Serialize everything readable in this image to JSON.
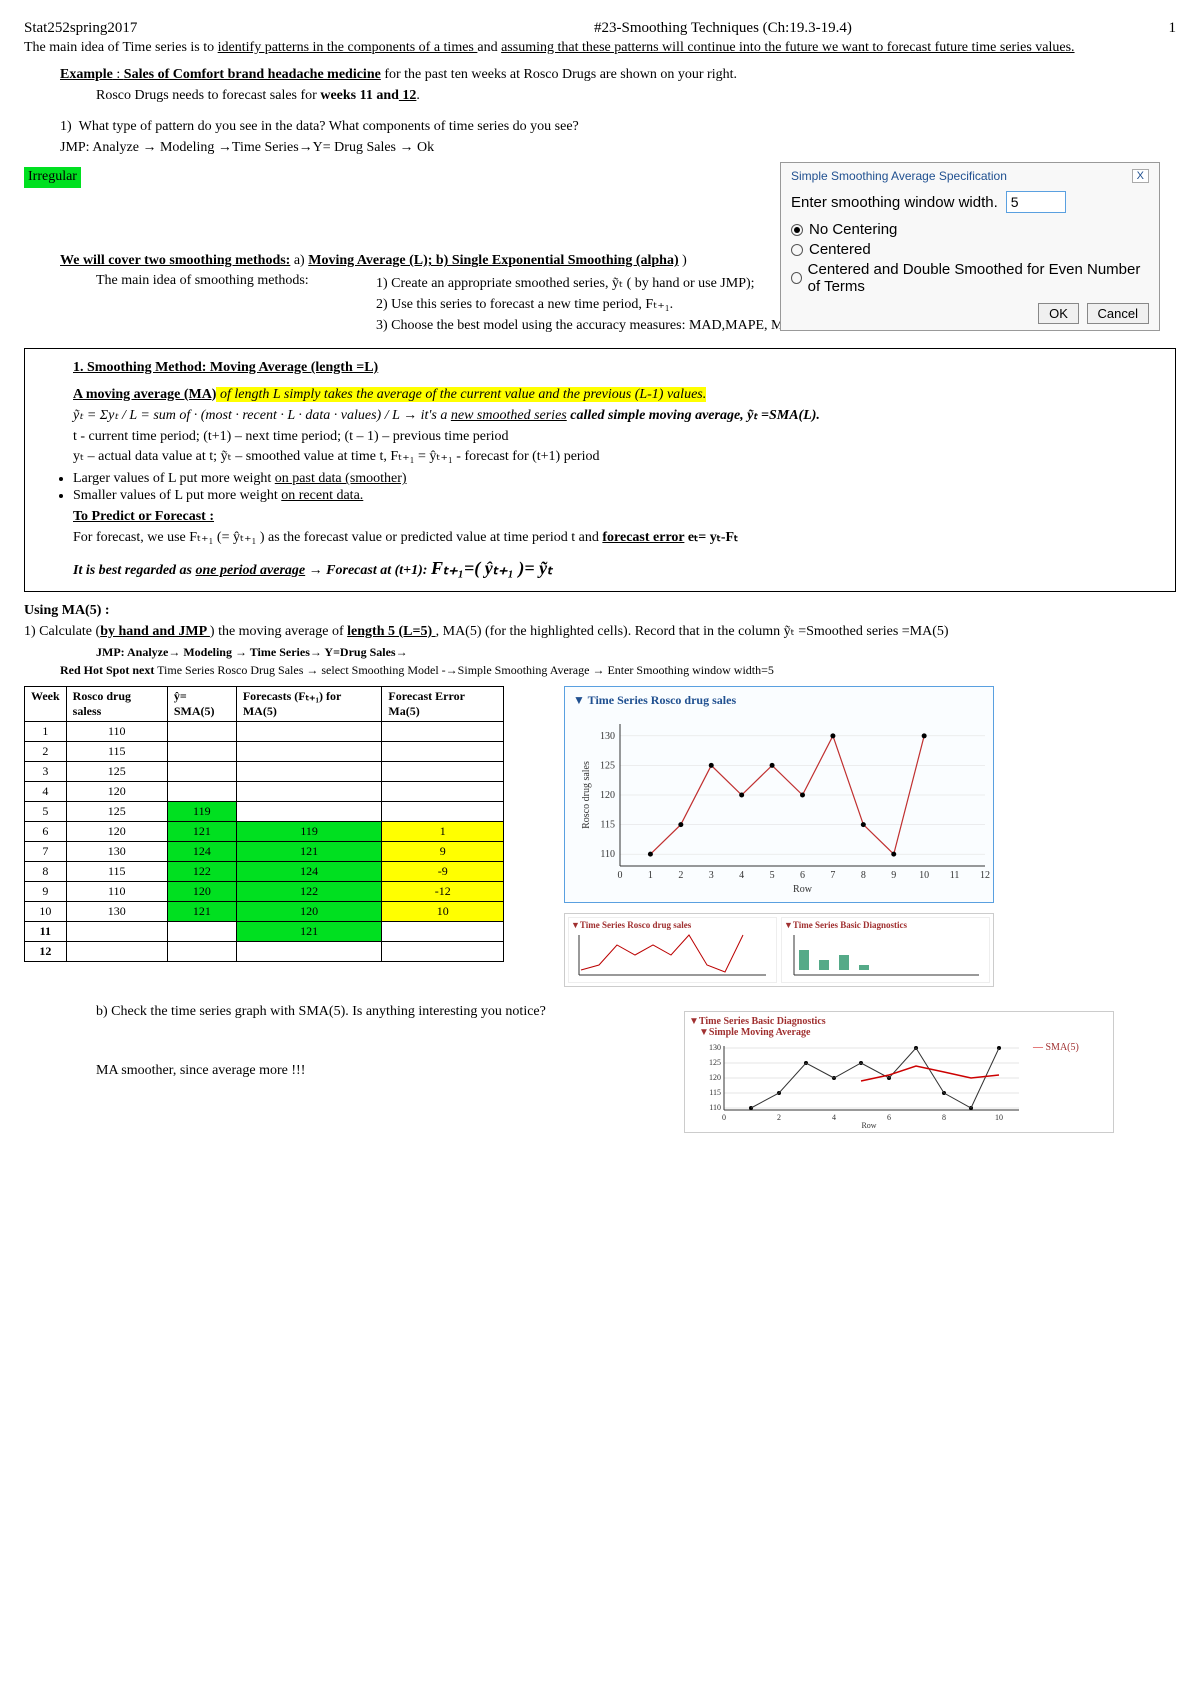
{
  "header": {
    "course": "Stat252spring2017",
    "title": "#23-Smoothing Techniques (Ch:19.3-19.4)",
    "page": "1"
  },
  "intro": {
    "line1a": "The main idea of Time series is to ",
    "line1b": "identify patterns in the components of a times ",
    "line1c": "and ",
    "line1d": "assuming that these patterns will continue into the future we want to forecast future time series values.",
    "example_pre": "Example",
    "example_title": "Sales of Comfort brand headache medicine",
    "example_rest": " for the past ten weeks at Rosco Drugs are shown on your right.",
    "rosco_line": "Rosco Drugs needs to forecast sales for ",
    "rosco_bold": "weeks 11 and",
    "rosco_bold2": " 12",
    "q1_num": "1)",
    "q1_text": "What type of pattern do you see in the data? What components of time series do you see?",
    "jmp_label": "JMP:",
    "jmp_path": "Analyze → Modeling →Time Series→Y= Drug Sales → Ok",
    "irregular": "Irregular"
  },
  "dialog": {
    "title": "Simple Smoothing Average Specification",
    "close": "X",
    "enter_label": "Enter smoothing window width.",
    "enter_value": "5",
    "r1": "No Centering",
    "r2": "Centered",
    "r3": "Centered and Double Smoothed for Even Number of Terms",
    "ok": "OK",
    "cancel": "Cancel"
  },
  "methods": {
    "cover_line_pre": "We will cover two smoothing methods:",
    "cover_line_a": " a) ",
    "cover_line_b": "Moving Average (L); b) Single Exponential Smoothing (alpha)",
    "cover_line_end": " )",
    "idea_label": "The main idea of smoothing methods:",
    "step1": "1) Create an appropriate smoothed series, ỹₜ ( by hand or use JMP);",
    "step2": "2)  Use this series to forecast a new time period, Fₜ₊₁.",
    "step3": "3)  Choose the best model using the accuracy measures: MAD,MAPE, MSD"
  },
  "box": {
    "h1": "1.   Smoothing Method: Moving Average (length =L)",
    "ma_line_pre": "A moving average (MA)",
    "ma_line_hl": " of length L simply takes the average of the current value and the previous (L-1) values.",
    "formula_text": "ỹₜ = Σyₜ / L = sum of · (most · recent · L · data · values) / L",
    "formula_after": " → it's a ",
    "formula_new": "new smoothed series",
    "formula_end": "  called simple moving average,  ỹₜ =SMA(L).",
    "defs1": "t - current time period; (t+1) – next time period; (t – 1) – previous time period",
    "defs2": "yₜ – actual data value at t;     ỹₜ – smoothed value  at time t,  Fₜ₊₁ = ŷₜ₊₁  - forecast for (t+1) period",
    "bul1a": "Larger values of L  put more weight ",
    "bul1b": "on past data (smoother)",
    "bul2a": "Smaller values of L  put more weight ",
    "bul2b": "on recent data.",
    "predict_h": "To Predict or Forecast :",
    "predict_line": "For forecast, we use Fₜ₊₁ (= ŷₜ₊₁ ) as the forecast value or predicted value at time period t and ",
    "predict_bold": "forecast error",
    "predict_eq": " eₜ= yₜ-Fₜ",
    "best_line_a": "It is best regarded as ",
    "best_line_b": "one period average",
    "best_line_c": " →  Forecast at (t+1):   ",
    "best_formula": "Fₜ₊₁=( ŷₜ₊₁ )=  ỹₜ"
  },
  "using": {
    "h": "Using MA(5) :",
    "step1_a": "1)  Calculate (",
    "step1_b": "by hand and JMP ",
    "step1_c": ") the moving average of ",
    "step1_d": "length 5 (L=5) ",
    "step1_e": ", MA(5) (for the highlighted cells).  Record that in the column  ỹₜ =Smoothed series =MA(5)",
    "jmp2": "JMP: Analyze→ Modeling → Time Series→ Y=Drug Sales→",
    "red_line": "Red Hot Spot next  Time Series Rosco Drug Sales → select Smoothing Model -→Simple Smoothing Average → Enter Smoothing window width=5",
    "b_line": "b)  Check the time series graph with SMA(5).  Is anything interesting you notice?",
    "ma_smoother": "MA smoother, since average more !!!"
  },
  "table": {
    "h_week": "Week",
    "h_sales": "Rosco drug saless",
    "h_sma": "ŷ= SMA(5)",
    "h_fc": "Forecasts (Fₜ₊₁) for MA(5)",
    "h_err": "Forecast Error Ma(5)",
    "rows": [
      {
        "week": "1",
        "sales": "110",
        "sma": "",
        "fc": "",
        "err": ""
      },
      {
        "week": "2",
        "sales": "115",
        "sma": "",
        "fc": "",
        "err": ""
      },
      {
        "week": "3",
        "sales": "125",
        "sma": "",
        "fc": "",
        "err": ""
      },
      {
        "week": "4",
        "sales": "120",
        "sma": "",
        "fc": "",
        "err": ""
      },
      {
        "week": "5",
        "sales": "125",
        "sma": "119",
        "fc": "",
        "err": ""
      },
      {
        "week": "6",
        "sales": "120",
        "sma": "121",
        "fc": "119",
        "err": "1"
      },
      {
        "week": "7",
        "sales": "130",
        "sma": "124",
        "fc": "121",
        "err": "9"
      },
      {
        "week": "8",
        "sales": "115",
        "sma": "122",
        "fc": "124",
        "err": "-9"
      },
      {
        "week": "9",
        "sales": "110",
        "sma": "120",
        "fc": "122",
        "err": "-12"
      },
      {
        "week": "10",
        "sales": "130",
        "sma": "121",
        "fc": "120",
        "err": "10"
      },
      {
        "week": "11",
        "sales": "",
        "sma": "",
        "fc": "121",
        "err": ""
      },
      {
        "week": "12",
        "sales": "",
        "sma": "",
        "fc": "",
        "err": ""
      }
    ]
  },
  "chart_data": {
    "type": "line",
    "title": "Time Series Rosco drug sales",
    "ylabel": "Rosco drug sales",
    "xlabel": "Row",
    "x": [
      1,
      2,
      3,
      4,
      5,
      6,
      7,
      8,
      9,
      10
    ],
    "values": [
      110,
      115,
      125,
      120,
      125,
      120,
      130,
      115,
      110,
      130
    ],
    "ylim": [
      108,
      132
    ],
    "xlim": [
      0,
      12
    ],
    "yticks": [
      110,
      115,
      120,
      125,
      130
    ],
    "xticks": [
      0,
      1,
      2,
      3,
      4,
      5,
      6,
      7,
      8,
      9,
      10,
      11,
      12
    ]
  },
  "small_panels": {
    "left_title": "Time Series Rosco drug sales",
    "right_title": "Time Series Basic Diagnostics"
  },
  "mov_avg": {
    "title1": "Time Series Basic Diagnostics",
    "title2": "Simple Moving Average",
    "legend": "SMA(5)",
    "yticks": [
      "110",
      "115",
      "120",
      "125",
      "130"
    ],
    "xticks": [
      "0",
      "2",
      "4",
      "6",
      "8",
      "10"
    ],
    "xlabel": "Row"
  }
}
